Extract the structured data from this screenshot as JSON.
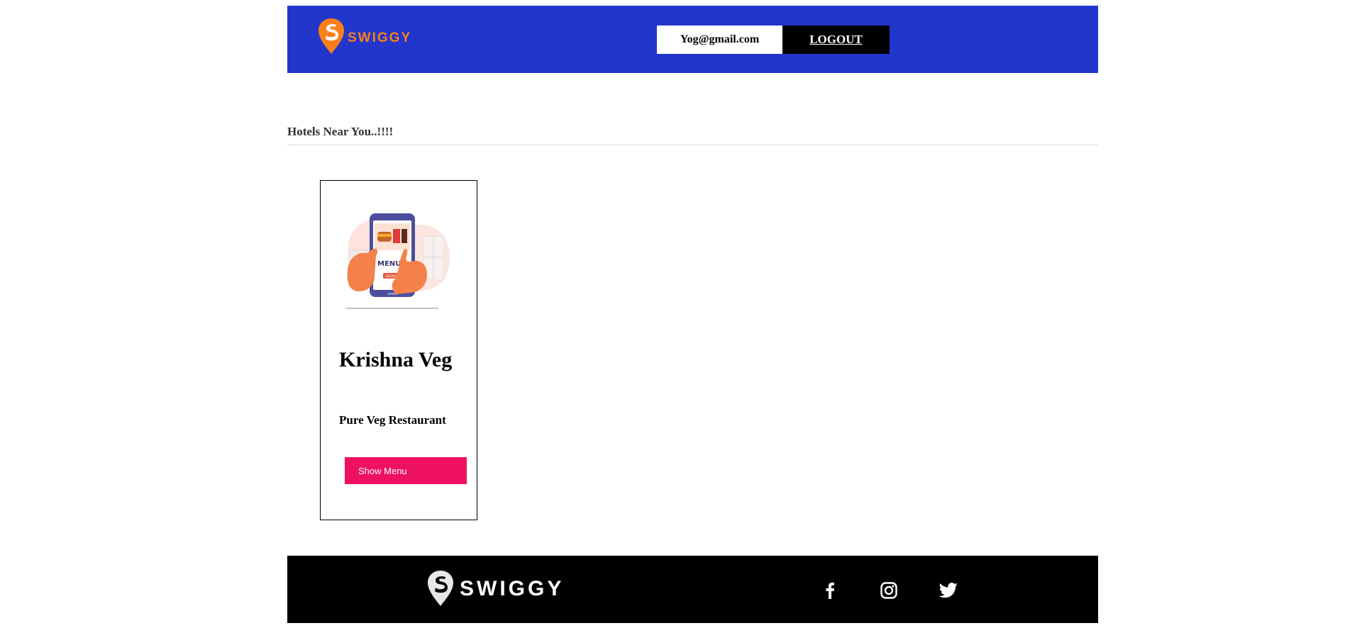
{
  "header": {
    "brand": "SWIGGY",
    "user_email": "Yog@gmail.com",
    "logout_label": "LOGOUT",
    "background_color": "#2336cc",
    "brand_color": "#fc8019"
  },
  "main": {
    "section_title": "Hotels Near You..!!!!",
    "hotels": [
      {
        "name": "Krishna Veg",
        "description": "Pure Veg Restaurant",
        "button_label": "Show Menu",
        "image_icon": "phone-menu-order-illustration",
        "button_color": "#ef1161"
      }
    ]
  },
  "footer": {
    "brand": "SWIGGY",
    "social_icons": [
      "facebook-icon",
      "instagram-icon",
      "twitter-icon"
    ]
  }
}
